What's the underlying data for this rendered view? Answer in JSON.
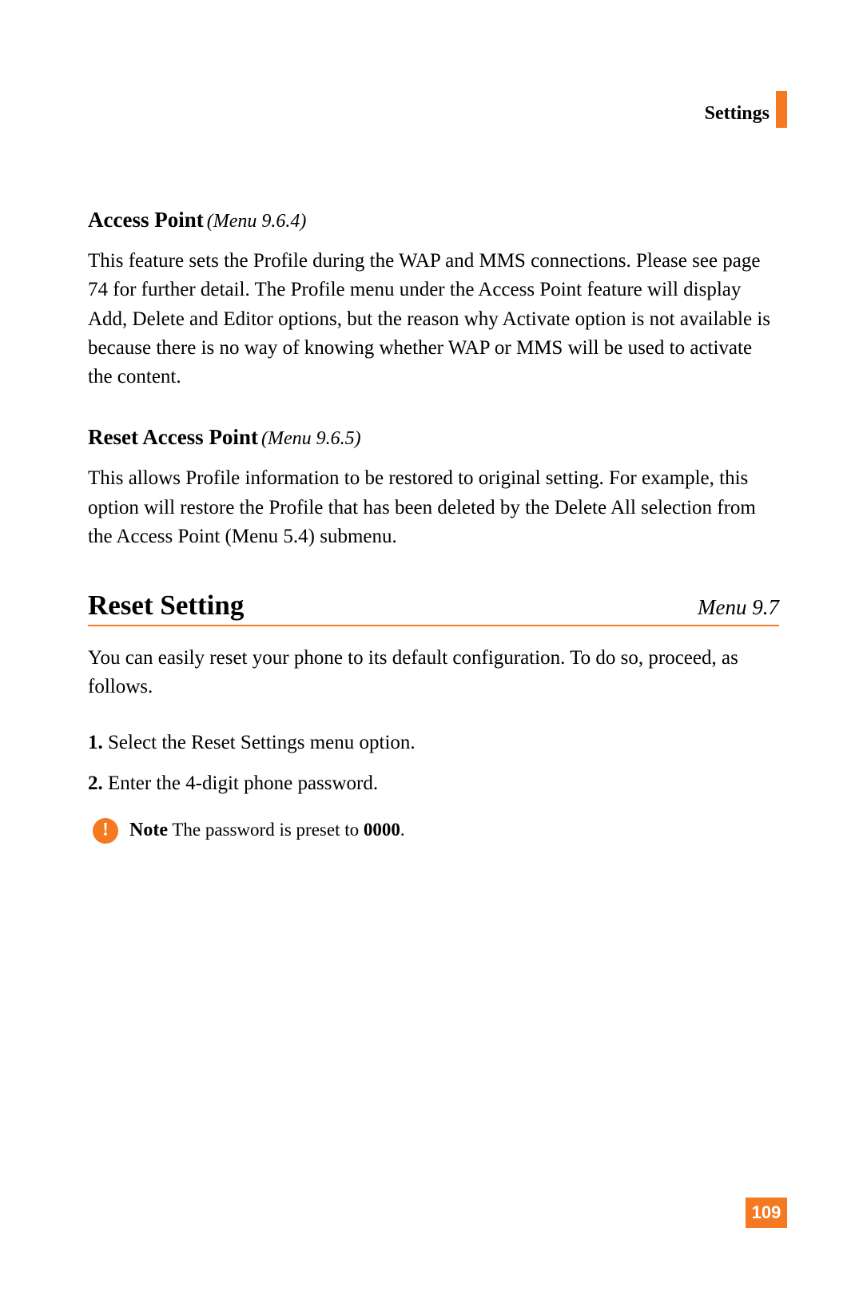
{
  "header": {
    "chapter": "Settings"
  },
  "sections": {
    "access_point": {
      "title": "Access Point",
      "menu_ref": " (Menu 9.6.4)",
      "body": "This feature sets the Profile during the WAP and MMS connections. Please see page 74 for further detail. The Profile menu under the Access Point feature will display Add, Delete and Editor options, but the reason why Activate option is not available is because there is no way of knowing whether WAP or MMS will be used to activate the content."
    },
    "reset_access_point": {
      "title": "Reset Access Point",
      "menu_ref": " (Menu 9.6.5)",
      "body": "This allows Profile information to be restored to original setting. For example, this option will restore the Profile that has been deleted by the Delete All selection from the Access Point (Menu 5.4) submenu."
    },
    "reset_setting": {
      "title": "Reset Setting",
      "menu_ref": "Menu 9.7",
      "intro": "You can easily reset your phone to its default configuration. To do so, proceed, as follows.",
      "steps": [
        {
          "num": "1.",
          "text": " Select the Reset Settings menu option."
        },
        {
          "num": "2.",
          "text": " Enter the 4-digit phone password."
        }
      ],
      "note": {
        "icon_glyph": "!",
        "label": "Note",
        "text_prefix": "  The password is preset to ",
        "bold": "0000",
        "suffix": "."
      }
    }
  },
  "page_number": "109"
}
